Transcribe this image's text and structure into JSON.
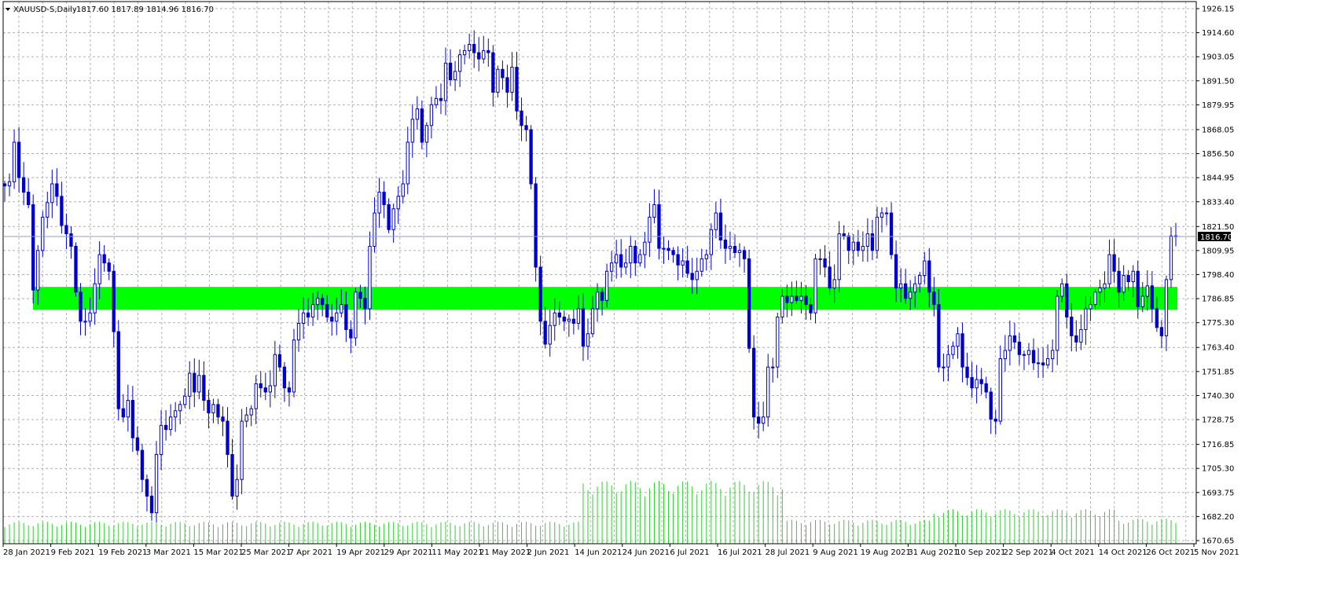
{
  "header": {
    "symbol": "XAUUSD-S,Daily",
    "ohlc": "1817.60 1817.89 1814.96 1816.70"
  },
  "colors": {
    "candle": "#0000cc",
    "grid": "#b0b0b0",
    "zone": "#00ff00",
    "volume": "#33cc33",
    "price_line": "#8aa0c0"
  },
  "chart_data": {
    "type": "candlestick",
    "symbol": "XAUUSD-S",
    "timeframe": "Daily",
    "ylim": [
      1670.65,
      1926.15
    ],
    "y_ticks": [
      1926.15,
      1914.6,
      1903.05,
      1891.5,
      1879.95,
      1868.05,
      1856.5,
      1844.95,
      1833.4,
      1821.5,
      1809.95,
      1798.4,
      1786.85,
      1775.3,
      1763.4,
      1751.85,
      1740.3,
      1728.75,
      1716.85,
      1705.3,
      1693.75,
      1682.2,
      1670.65
    ],
    "x_ticks": [
      "28 Jan 2021",
      "9 Feb 2021",
      "19 Feb 2021",
      "3 Mar 2021",
      "15 Mar 2021",
      "25 Mar 2021",
      "7 Apr 2021",
      "19 Apr 2021",
      "29 Apr 2021",
      "11 May 2021",
      "21 May 2021",
      "2 Jun 2021",
      "14 Jun 2021",
      "24 Jun 2021",
      "6 Jul 2021",
      "16 Jul 2021",
      "28 Jul 2021",
      "9 Aug 2021",
      "19 Aug 2021",
      "31 Aug 2021",
      "10 Sep 2021",
      "22 Sep 2021",
      "4 Oct 2021",
      "14 Oct 2021",
      "26 Oct 2021",
      "5 Nov 2021"
    ],
    "current_price": 1816.7,
    "last_close_label": "1816.70",
    "zone": {
      "from": 1781.5,
      "to": 1792.5
    },
    "closes": [
      1841,
      1843,
      1862,
      1845,
      1838,
      1832,
      1791,
      1810,
      1826,
      1833,
      1842,
      1836,
      1822,
      1818,
      1812,
      1790,
      1776,
      1776,
      1780,
      1794,
      1808,
      1804,
      1800,
      1771,
      1734,
      1730,
      1738,
      1720,
      1714,
      1700,
      1692,
      1684,
      1712,
      1726,
      1724,
      1730,
      1733,
      1736,
      1740,
      1751,
      1742,
      1750,
      1738,
      1732,
      1736,
      1730,
      1728,
      1712,
      1692,
      1700,
      1728,
      1731,
      1734,
      1746,
      1744,
      1742,
      1745,
      1760,
      1754,
      1744,
      1742,
      1767,
      1775,
      1780,
      1778,
      1784,
      1787,
      1784,
      1778,
      1776,
      1780,
      1784,
      1772,
      1768,
      1790,
      1787,
      1782,
      1812,
      1828,
      1838,
      1832,
      1820,
      1830,
      1836,
      1842,
      1862,
      1873,
      1878,
      1862,
      1870,
      1880,
      1883,
      1882,
      1900,
      1892,
      1896,
      1904,
      1906,
      1909,
      1905,
      1902,
      1906,
      1905,
      1886,
      1897,
      1893,
      1886,
      1898,
      1877,
      1870,
      1868,
      1842,
      1802,
      1776,
      1765,
      1774,
      1780,
      1778,
      1776,
      1777,
      1775,
      1782,
      1764,
      1770,
      1782,
      1790,
      1786,
      1800,
      1804,
      1808,
      1802,
      1804,
      1812,
      1804,
      1808,
      1814,
      1826,
      1832,
      1811,
      1811,
      1810,
      1808,
      1803,
      1805,
      1799,
      1796,
      1800,
      1806,
      1808,
      1820,
      1828,
      1815,
      1811,
      1812,
      1809,
      1810,
      1806,
      1763,
      1730,
      1727,
      1730,
      1754,
      1754,
      1778,
      1788,
      1785,
      1788,
      1786,
      1788,
      1784,
      1780,
      1806,
      1806,
      1802,
      1792,
      1796,
      1818,
      1817,
      1810,
      1814,
      1810,
      1812,
      1818,
      1810,
      1826,
      1828,
      1828,
      1808,
      1792,
      1794,
      1787,
      1790,
      1794,
      1798,
      1805,
      1790,
      1784,
      1754,
      1754,
      1760,
      1764,
      1770,
      1754,
      1749,
      1744,
      1748,
      1746,
      1742,
      1729,
      1728,
      1758,
      1762,
      1769,
      1766,
      1760,
      1760,
      1762,
      1756,
      1756,
      1755,
      1758,
      1762,
      1788,
      1794,
      1778,
      1769,
      1766,
      1772,
      1782,
      1784,
      1790,
      1792,
      1794,
      1808,
      1800,
      1790,
      1798,
      1795,
      1800,
      1783,
      1788,
      1793,
      1782,
      1773,
      1769,
      1796,
      1817,
      1816.7
    ],
    "volume_profile": [
      0.35,
      1.0,
      0.38,
      0.55,
      0.4,
      0.2,
      0.18
    ]
  }
}
